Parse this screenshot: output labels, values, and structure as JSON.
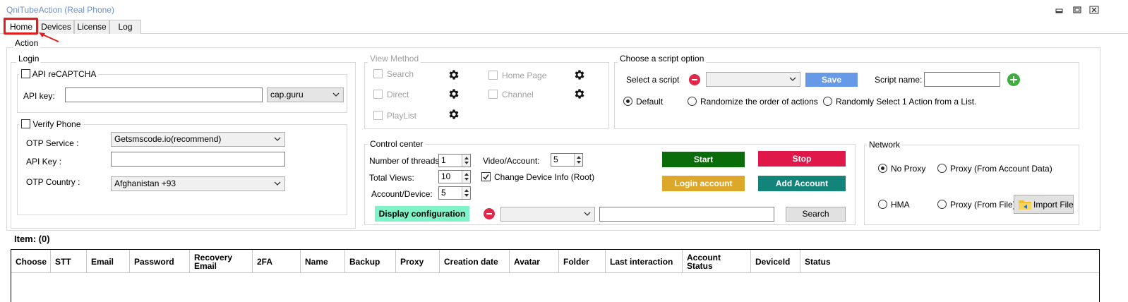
{
  "window": {
    "title": "QniTubeAction (Real Phone)"
  },
  "tabs": [
    {
      "label": "Home",
      "active": true
    },
    {
      "label": "Devices"
    },
    {
      "label": "License"
    },
    {
      "label": "Log"
    }
  ],
  "action_group": {
    "label": "Action"
  },
  "login": {
    "label": "Login",
    "recaptcha": {
      "label": "API reCAPTCHA",
      "checked": false
    },
    "api_key_label": "API key:",
    "api_key_value": "",
    "captcha_service": "cap.guru",
    "verify_phone": {
      "label": "Verify Phone",
      "checked": false
    },
    "otp_service_label": "OTP Service :",
    "otp_service_value": "Getsmscode.io(recommend)",
    "otp_api_key_label": "API Key :",
    "otp_api_key_value": "",
    "otp_country_label": "OTP Country :",
    "otp_country_value": "Afghanistan +93"
  },
  "view_method": {
    "label": "View Method",
    "items": [
      "Search",
      "Direct",
      "PlayList",
      "Home Page",
      "Channel"
    ]
  },
  "script_option": {
    "label": "Choose a script option",
    "select_label": "Select a script",
    "select_value": "",
    "save_label": "Save",
    "script_name_label": "Script name:",
    "script_name_value": "",
    "radios": [
      {
        "label": "Default",
        "checked": true
      },
      {
        "label": "Randomize the order of actions",
        "checked": false
      },
      {
        "label": "Randomly Select 1 Action from a List.",
        "checked": false
      }
    ]
  },
  "control_center": {
    "label": "Control center",
    "threads_label": "Number of threads:",
    "threads_value": "1",
    "views_label": "Total Views:",
    "views_value": "10",
    "acct_device_label": "Account/Device:",
    "acct_device_value": "5",
    "video_acct_label": "Video/Account:",
    "video_acct_value": "5",
    "change_device_label": "Change Device Info (Root)",
    "change_device_checked": true,
    "start_label": "Start",
    "stop_label": "Stop",
    "login_account_label": "Login account",
    "add_account_label": "Add Account",
    "display_config_label": "Display configuration",
    "filter_value": "",
    "search_value": "",
    "search_label": "Search"
  },
  "network": {
    "label": "Network",
    "options": [
      {
        "label": "No Proxy",
        "checked": true
      },
      {
        "label": "Proxy (From Account Data)",
        "checked": false
      },
      {
        "label": "HMA",
        "checked": false
      },
      {
        "label": "Proxy (From File)",
        "checked": false
      }
    ],
    "import_label": "Import File"
  },
  "items": {
    "label": "Item: (0)"
  },
  "table": {
    "columns": [
      "Choose",
      "STT",
      "Email",
      "Password",
      "Recovery Email",
      "2FA",
      "Name",
      "Backup",
      "Proxy",
      "Creation date",
      "Avatar",
      "Folder",
      "Last interaction",
      "Account Status",
      "DeviceId",
      "Status"
    ]
  },
  "colors": {
    "start": "#0a6d0a",
    "stop": "#e0184a",
    "login_account": "#dda72a",
    "add_account": "#12847a",
    "save": "#6699e8",
    "display_config": "#7ff2c8",
    "highlight": "#e11d1d"
  }
}
